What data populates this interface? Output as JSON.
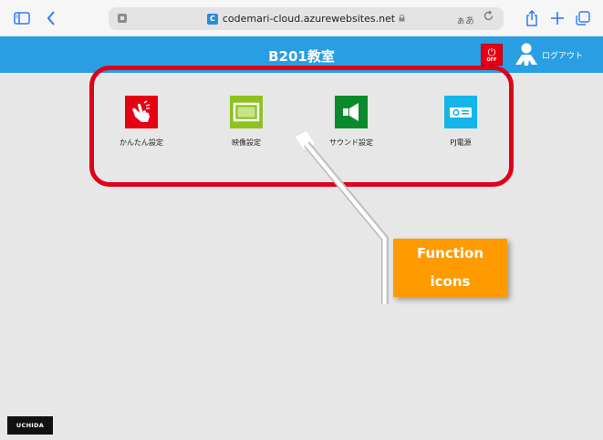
{
  "browser": {
    "url": "codemari-cloud.azurewebsites.net",
    "favicon_letter": "C",
    "lock_icon": "lock-icon",
    "text_size_label": "ぁあ",
    "reload_icon": "reload-icon"
  },
  "header": {
    "title": "B201教室",
    "power_off_label": "OFF",
    "logout_label": "ログアウト",
    "bg_color": "#2a9ee3"
  },
  "functions": [
    {
      "label": "かんたん設定",
      "icon": "touch-hand-icon",
      "color": "#e60012"
    },
    {
      "label": "映像設定",
      "icon": "display-screen-icon",
      "color": "#8ec31f"
    },
    {
      "label": "サウンド設定",
      "icon": "speaker-icon",
      "color": "#0a8a2a"
    },
    {
      "label": "PJ電源",
      "icon": "projector-icon",
      "color": "#13b5ea"
    }
  ],
  "annotation": {
    "line1": "Function",
    "line2": "icons",
    "color": "#ff9b00",
    "highlight_color": "#e0001a"
  },
  "footer": {
    "brand": "UCHIDA"
  }
}
